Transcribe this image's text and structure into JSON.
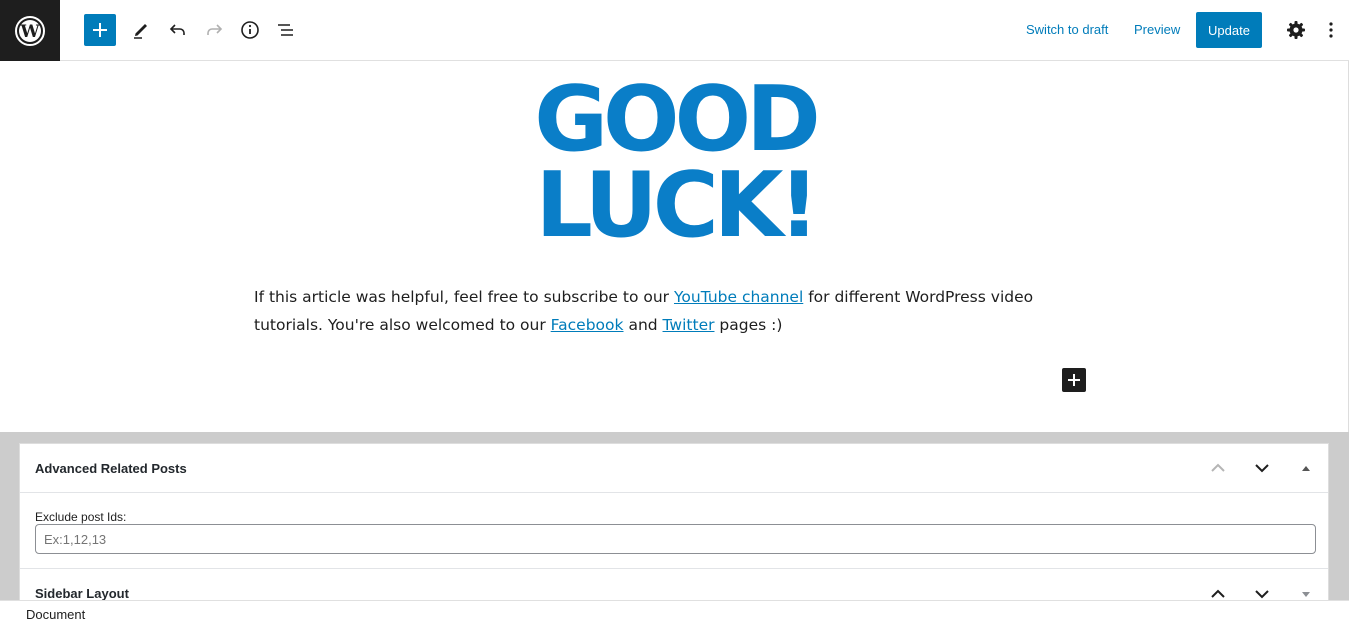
{
  "toolbar": {
    "switch_to_draft": "Switch to draft",
    "preview": "Preview",
    "update": "Update"
  },
  "content": {
    "image_text_line1": "GOOD",
    "image_text_line2": "LUCK!",
    "paragraph_part1": "If this article was helpful, feel free to subscribe to our ",
    "link_youtube": "YouTube channel",
    "paragraph_part2": " for different WordPress video tutorials. You're also welcomed to our ",
    "link_facebook": "Facebook",
    "paragraph_part3": " and ",
    "link_twitter": "Twitter",
    "paragraph_part4": " pages :)"
  },
  "metaboxes": {
    "related_posts": {
      "title": "Advanced Related Posts",
      "field_label": "Exclude post Ids:",
      "field_placeholder": "Ex:1,12,13",
      "field_value": ""
    },
    "sidebar_layout": {
      "title": "Sidebar Layout"
    }
  },
  "footer": {
    "breadcrumb": "Document"
  },
  "colors": {
    "accent": "#007cba",
    "image_blue": "#0a7ec8",
    "dark": "#1e1e1e",
    "metabox_bg": "#cccccc"
  },
  "icons": [
    "wordpress-logo-icon",
    "plus-icon",
    "pencil-icon",
    "undo-icon",
    "redo-icon",
    "info-icon",
    "list-view-icon",
    "gear-icon",
    "more-vertical-icon",
    "chevron-up-icon",
    "chevron-down-icon",
    "triangle-up-icon",
    "triangle-down-icon"
  ]
}
